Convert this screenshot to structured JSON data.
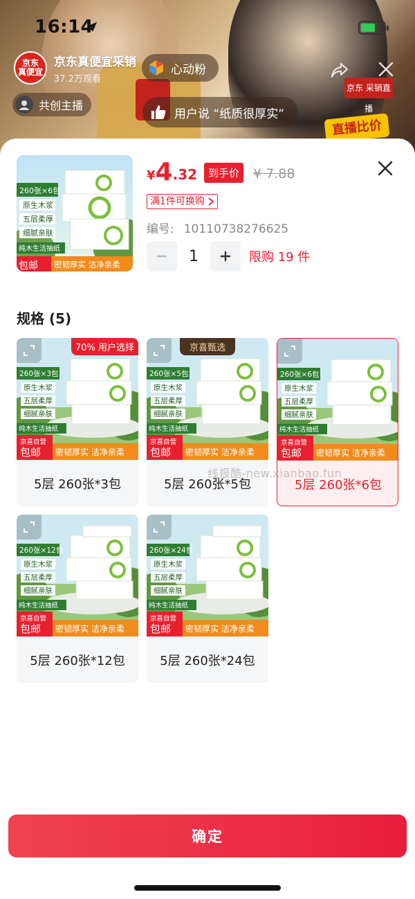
{
  "status_bar": {
    "time": "16:14"
  },
  "live_room": {
    "avatar_text": "京东真便宜采销",
    "name": "京东真便宜采销",
    "viewers": "37.2万观看",
    "follow_label": "心动粉",
    "co_host_label": "共创主播",
    "comment": "用户说 “纸质很厚实”",
    "promo_text": "直播比价",
    "side_sign": "京东 采销直播"
  },
  "product": {
    "thumb_pack": "260张×6包",
    "price_symbol": "¥",
    "price_int": "4",
    "price_dec": ".32",
    "price_tag": "到手价",
    "orig_price": "¥ 7.88",
    "promo": "满1件可换购",
    "id_label": "编号:",
    "id_value": "10110738276625",
    "quantity": "1",
    "limit": "限购 19 件"
  },
  "product_art": {
    "features": [
      "原生木浆",
      "五层柔厚",
      "细腻亲肤"
    ],
    "footer_left_top": "京喜自营",
    "footer_left_main": "包邮",
    "footer_right": "密韧厚实 洁净亲柔",
    "brand": "纯木生活抽纸"
  },
  "spec": {
    "title": "规格 (5)",
    "items": [
      {
        "label": "5层 260张*3包",
        "pack": "260张×3包",
        "badge": "70% 用户选择",
        "banner": "",
        "selected": false
      },
      {
        "label": "5层 260张*5包",
        "pack": "260张×5包",
        "badge": "",
        "banner": "京喜甄选",
        "selected": false
      },
      {
        "label": "5层 260张*6包",
        "pack": "260张×6包",
        "badge": "",
        "banner": "",
        "selected": true
      },
      {
        "label": "5层 260张*12包",
        "pack": "260张×12包",
        "badge": "",
        "banner": "",
        "selected": false
      },
      {
        "label": "5层 260张*24包",
        "pack": "260张×24包",
        "badge": "",
        "banner": "",
        "selected": false
      }
    ]
  },
  "watermark": "线报酷-new.xianbao.fun",
  "confirm_label": "确定",
  "colors": {
    "accent": "#e8202e",
    "confirm": "#ef3346"
  }
}
